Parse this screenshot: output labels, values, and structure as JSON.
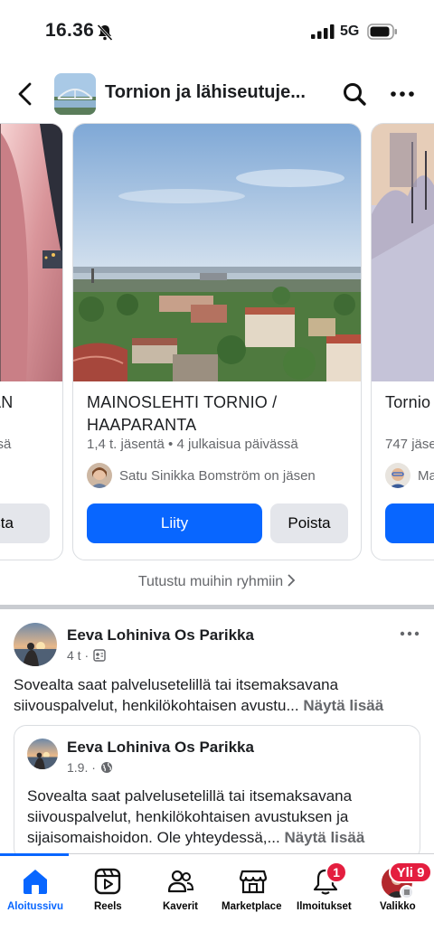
{
  "status_bar": {
    "time": "16.36",
    "network": "5G"
  },
  "header": {
    "title": "Tornion ja lähiseutuje..."
  },
  "cards": [
    {
      "name": "AN",
      "meta": "ssä",
      "remove_label": "oista"
    },
    {
      "name": "MAINOSLEHTI  TORNIO / HAAPARANTA",
      "meta": "1,4 t. jäsentä • 4 julkaisua päivässä",
      "member_text": "Satu Sinikka Bomström on jäsen",
      "join_label": "Liity",
      "remove_label": "Poista"
    },
    {
      "name": "Tornio",
      "meta": "747 jäse",
      "member_text": "Ma"
    }
  ],
  "more_groups": "Tutustu muihin ryhmiin",
  "post": {
    "author": "Eeva Lohiniva Os Parikka",
    "time": "4 t",
    "text": "Sovealta saat palvelusetelillä tai itsemaksavana siivouspalvelut, henkilökohtaisen avustu...",
    "see_more": "Näytä lisää",
    "shared": {
      "author": "Eeva Lohiniva Os Parikka",
      "time": "1.9.",
      "text": "Sovealta saat palvelusetelillä tai itsemaksavana siivouspalvelut, henkilökohtaisen avustuksen ja sijaisomaishoidon. Ole yhteydessä,...",
      "see_more": "Näytä lisää"
    }
  },
  "tabs": [
    {
      "label": "Aloitussivu",
      "icon": "home-icon",
      "active": true
    },
    {
      "label": "Reels",
      "icon": "reels-icon"
    },
    {
      "label": "Kaverit",
      "icon": "friends-icon"
    },
    {
      "label": "Marketplace",
      "icon": "marketplace-icon"
    },
    {
      "label": "Ilmoitukset",
      "icon": "bell-icon",
      "badge": "1"
    },
    {
      "label": "Valikko",
      "icon": "profile-avatar",
      "badge": "Yli 9"
    }
  ],
  "colors": {
    "accent": "#0866ff",
    "badge": "#e41e3f",
    "secondary_text": "#65676b"
  }
}
